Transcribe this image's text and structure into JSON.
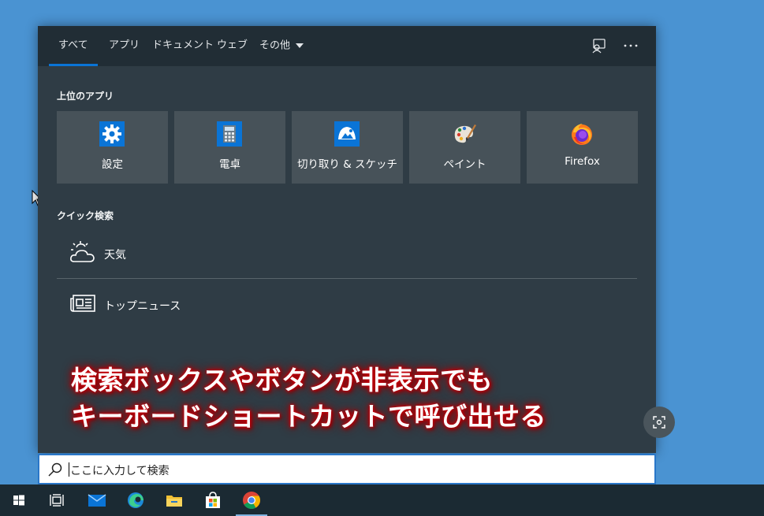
{
  "tabs": [
    {
      "label": "すべて",
      "active": true
    },
    {
      "label": "アプリ",
      "active": false
    },
    {
      "label": "ドキュメント",
      "active": false
    },
    {
      "label": "ウェブ",
      "active": false
    },
    {
      "label": "その他",
      "active": false
    }
  ],
  "toolbar_icons": [
    "feedback-icon",
    "more-options-icon"
  ],
  "top_apps": {
    "title": "上位のアプリ",
    "items": [
      {
        "label": "設定",
        "icon": "settings-gear-icon"
      },
      {
        "label": "電卓",
        "icon": "calculator-icon"
      },
      {
        "label": "切り取り & スケッチ",
        "icon": "snip-sketch-icon"
      },
      {
        "label": "ペイント",
        "icon": "paint-palette-icon"
      },
      {
        "label": "Firefox",
        "icon": "firefox-icon"
      }
    ]
  },
  "quick_search": {
    "title": "クイック検索",
    "items": [
      {
        "label": "天気",
        "icon": "weather-icon"
      },
      {
        "label": "トップニュース",
        "icon": "news-icon"
      }
    ]
  },
  "overlay_caption": {
    "line1": "検索ボックスやボタンが非表示でも",
    "line2": "キーボードショートカットで呼び出せる"
  },
  "search": {
    "placeholder": "ここに入力して検索"
  },
  "taskbar": {
    "items": [
      "start-button",
      "task-view",
      "mail",
      "edge",
      "file-explorer",
      "store",
      "chrome"
    ]
  },
  "colors": {
    "desktop": "#4a93d2",
    "panel": "#2f3c45",
    "tabbar": "#212d35",
    "tile": "#475259",
    "accent": "#0a74d6",
    "caption_glow": "#c8000a"
  }
}
